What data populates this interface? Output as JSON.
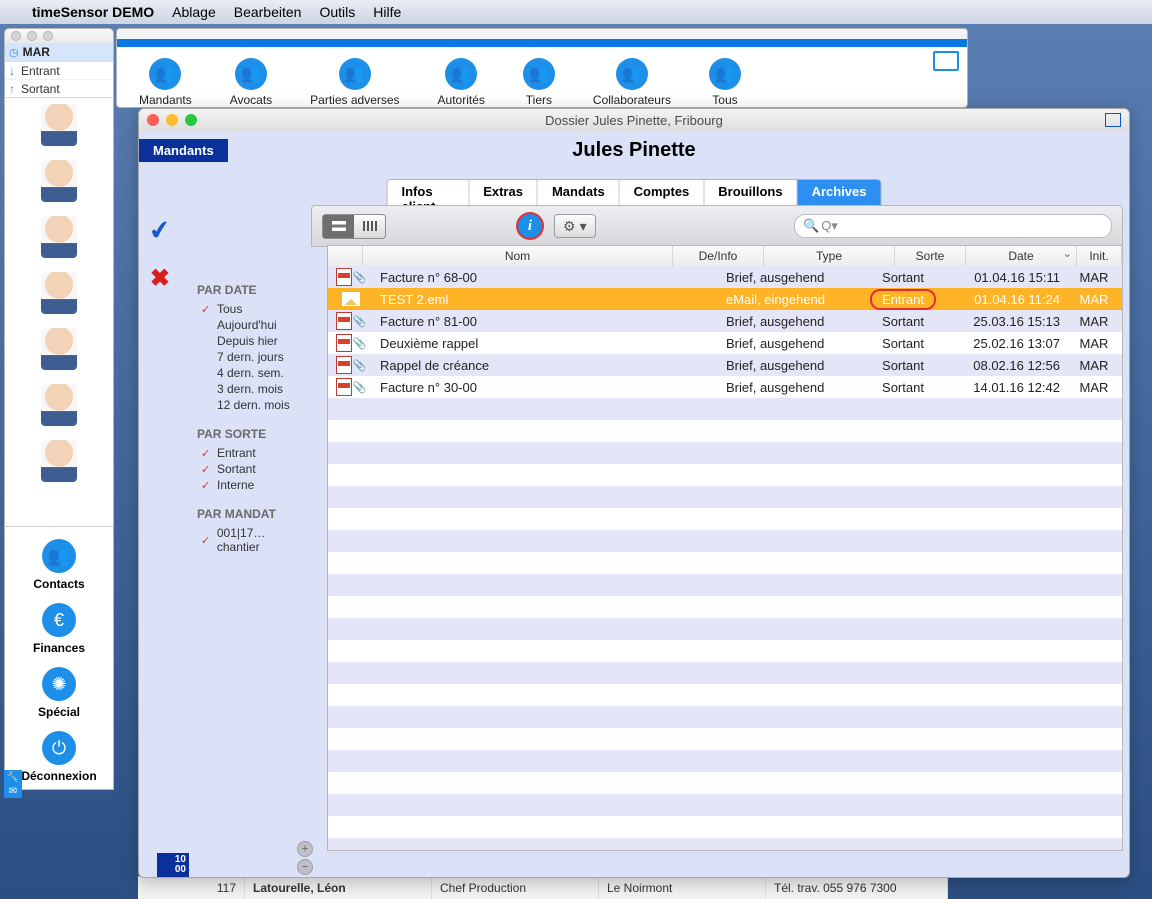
{
  "menubar": {
    "app": "timeSensor DEMO",
    "items": [
      "Ablage",
      "Bearbeiten",
      "Outils",
      "Hilfe"
    ]
  },
  "side_search": "MAR",
  "side_items": [
    {
      "glyph": "↓",
      "label": "Entrant"
    },
    {
      "glyph": "↑",
      "label": "Sortant"
    }
  ],
  "nav": [
    {
      "icon": "people",
      "label": "Contacts"
    },
    {
      "icon": "euro",
      "label": "Finances"
    },
    {
      "icon": "wheel",
      "label": "Spécial"
    },
    {
      "icon": "power",
      "label": "Déconnexion"
    }
  ],
  "contacts_toolbar": [
    "Mandants",
    "Avocats",
    "Parties adverses",
    "Autorités",
    "Tiers",
    "Collaborateurs",
    "Tous"
  ],
  "dossier": {
    "title": "Dossier Jules Pinette, Fribourg",
    "mandants_chip": "Mandants",
    "person": "Jules Pinette",
    "tabs": [
      "Infos client",
      "Extras",
      "Mandats",
      "Comptes",
      "Brouillons",
      "Archives"
    ],
    "active_tab": "Archives",
    "search_placeholder": "Q▾",
    "filters": {
      "par_date": {
        "hdr": "PAR DATE",
        "items": [
          {
            "chk": true,
            "label": "Tous"
          },
          {
            "chk": false,
            "label": "Aujourd'hui"
          },
          {
            "chk": false,
            "label": "Depuis hier"
          },
          {
            "chk": false,
            "label": "7 dern. jours"
          },
          {
            "chk": false,
            "label": "4 dern. sem."
          },
          {
            "chk": false,
            "label": "3 dern. mois"
          },
          {
            "chk": false,
            "label": "12 dern. mois"
          }
        ]
      },
      "par_sorte": {
        "hdr": "PAR SORTE",
        "items": [
          {
            "chk": true,
            "label": "Entrant"
          },
          {
            "chk": true,
            "label": "Sortant"
          },
          {
            "chk": true,
            "label": "Interne"
          }
        ]
      },
      "par_mandat": {
        "hdr": "PAR MANDAT",
        "items": [
          {
            "chk": true,
            "label": "001|17…chantier"
          }
        ]
      }
    },
    "columns": [
      "",
      "Nom",
      "De/Info",
      "Type",
      "Sorte",
      "Date",
      "Init."
    ],
    "rows": [
      {
        "icon": "pdf",
        "nom": "Facture n° 68-00",
        "de": "",
        "type": "Brief, ausgehend",
        "sorte": "Sortant",
        "date": "01.04.16 15:11",
        "init": "MAR",
        "sel": false
      },
      {
        "icon": "mail",
        "nom": "TEST 2.eml",
        "de": "",
        "type": "eMail, eingehend",
        "sorte": "Entrant",
        "date": "01.04.16 11:24",
        "init": "MAR",
        "sel": true,
        "ring": true
      },
      {
        "icon": "pdf",
        "nom": "Facture n° 81-00",
        "de": "",
        "type": "Brief, ausgehend",
        "sorte": "Sortant",
        "date": "25.03.16 15:13",
        "init": "MAR",
        "sel": false
      },
      {
        "icon": "pdf",
        "nom": "Deuxième rappel",
        "de": "",
        "type": "Brief, ausgehend",
        "sorte": "Sortant",
        "date": "25.02.16 13:07",
        "init": "MAR",
        "sel": false
      },
      {
        "icon": "pdf",
        "nom": "Rappel de créance",
        "de": "",
        "type": "Brief, ausgehend",
        "sorte": "Sortant",
        "date": "08.02.16 12:56",
        "init": "MAR",
        "sel": false
      },
      {
        "icon": "pdf",
        "nom": "Facture n° 30-00",
        "de": "",
        "type": "Brief, ausgehend",
        "sorte": "Sortant",
        "date": "14.01.16 12:42",
        "init": "MAR",
        "sel": false
      }
    ],
    "counter_top": "10",
    "counter_bottom": "00"
  },
  "bg_row": {
    "num": "117",
    "name": "Latourelle, Léon",
    "role": "Chef Production",
    "city": "Le Noirmont",
    "phone": "Tél. trav. 055 976 7300"
  }
}
